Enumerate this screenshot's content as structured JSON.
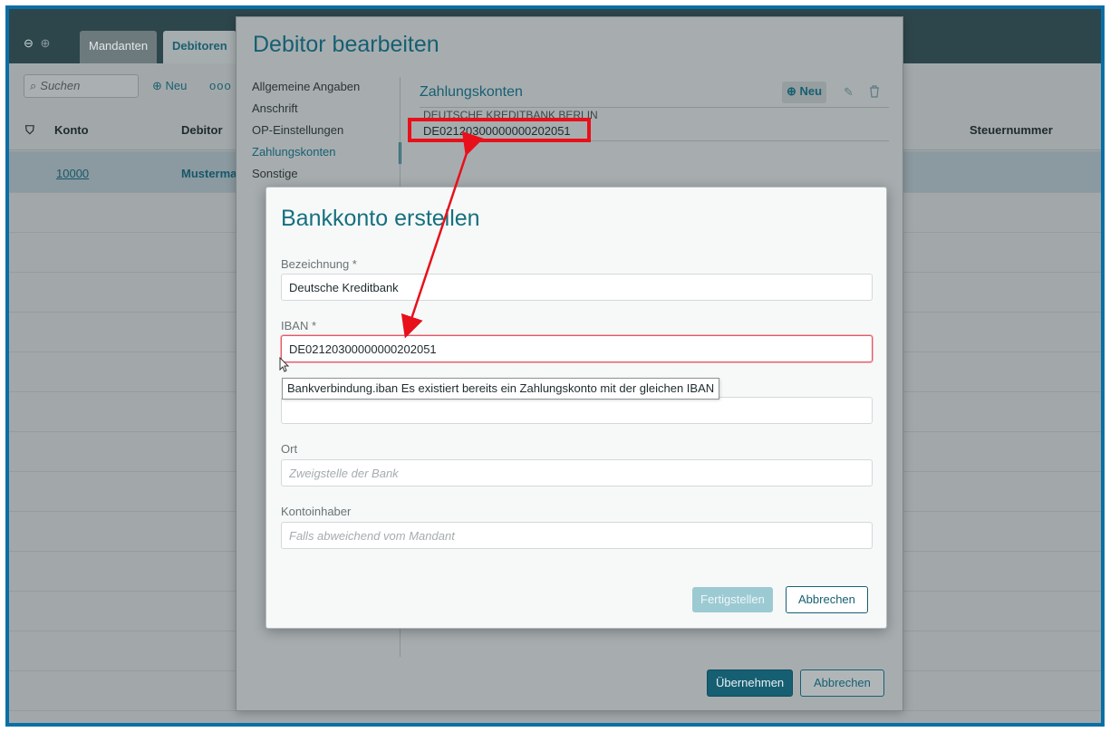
{
  "app": {
    "tabs": [
      {
        "label": "Mandanten"
      },
      {
        "label": "Debitoren"
      }
    ],
    "search_placeholder": "Suchen",
    "new_label": "Neu",
    "more_label": "ooo",
    "columns": {
      "konto": "Konto",
      "debitor": "Debitor",
      "steuernummer": "Steuernummer"
    },
    "rows": [
      {
        "konto": "10000",
        "debitor": "Musterma"
      }
    ]
  },
  "debitor_dialog": {
    "title": "Debitor bearbeiten",
    "nav": [
      {
        "label": "Allgemeine Angaben"
      },
      {
        "label": "Anschrift"
      },
      {
        "label": "OP-Einstellungen"
      },
      {
        "label": "Zahlungskonten"
      },
      {
        "label": "Sonstige"
      }
    ],
    "zahlungskonten": {
      "title": "Zahlungskonten",
      "new_label": "Neu",
      "bank_name": "DEUTSCHE KREDITBANK BERLIN",
      "iban": "DE02120300000000202051"
    },
    "buttons": {
      "ok": "Übernehmen",
      "cancel": "Abbrechen"
    }
  },
  "bank_dialog": {
    "title": "Bankkonto erstellen",
    "fields": {
      "bezeichnung": {
        "label": "Bezeichnung *",
        "value": "Deutsche Kreditbank"
      },
      "iban": {
        "label": "IBAN *",
        "value": "DE02120300000000202051"
      },
      "bic": {
        "value": ""
      },
      "ort": {
        "label": "Ort",
        "placeholder": "Zweigstelle der Bank"
      },
      "kontoinhaber": {
        "label": "Kontoinhaber",
        "placeholder": "Falls abweichend vom Mandant"
      }
    },
    "tooltip": "Bankverbindung.iban Es existiert bereits ein Zahlungskonto mit der gleichen IBAN",
    "buttons": {
      "finish": "Fertigstellen",
      "cancel": "Abbrechen"
    }
  },
  "colors": {
    "accent": "#165f72",
    "highlight_red": "#e8101a",
    "frame_blue": "#0b6fa6"
  }
}
